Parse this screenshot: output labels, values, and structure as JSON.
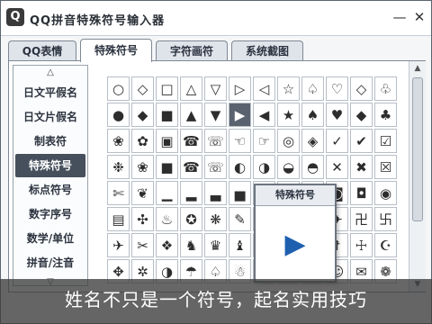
{
  "window": {
    "title": "QQ拼音特殊符号输入器",
    "app_icon": "Q",
    "minimize_glyph": "—",
    "close_glyph": "✕"
  },
  "tabs": [
    {
      "label": "QQ表情"
    },
    {
      "label": "特殊符号"
    },
    {
      "label": "字符画符"
    },
    {
      "label": "系统截图"
    }
  ],
  "categories": {
    "up_glyph": "△",
    "down_glyph": "▽",
    "items": [
      {
        "label": "日文平假名"
      },
      {
        "label": "日文片假名"
      },
      {
        "label": "制表符"
      },
      {
        "label": "特殊符号"
      },
      {
        "label": "标点符号"
      },
      {
        "label": "数字序号"
      },
      {
        "label": "数学/单位"
      },
      {
        "label": "拼音/注音"
      }
    ]
  },
  "symbols": {
    "rows": [
      [
        "○",
        "◇",
        "□",
        "△",
        "▽",
        "▷",
        "◁",
        "☆",
        "♤",
        "♡",
        "◇",
        "♧"
      ],
      [
        "●",
        "◆",
        "■",
        "▲",
        "▼",
        "▶",
        "◀",
        "★",
        "♠",
        "♥",
        "◆",
        "♣"
      ],
      [
        "❀",
        "✿",
        "▣",
        "☎",
        "☏",
        "☜",
        "☞",
        "◎",
        "◈",
        "✓",
        "✔",
        "☑"
      ],
      [
        "❉",
        "❀",
        "■",
        "☎",
        "☏",
        "◐",
        "◑",
        "◒",
        "◓",
        "✕",
        "✖",
        "☒"
      ],
      [
        "✄",
        "❦",
        "▁",
        "▂",
        "▃",
        "▅",
        "▆",
        "▇",
        "█",
        "◙",
        "◘",
        "◉"
      ],
      [
        "▤",
        "✣",
        "♨",
        "✪",
        "❋",
        "✎",
        "✐",
        "✂",
        "✁",
        "✈",
        "卍",
        "卐"
      ],
      [
        "✈",
        "✂",
        "❖",
        "♞",
        "♛",
        "♝",
        "✙",
        "✝",
        "✞",
        "☨",
        "☩",
        "☪"
      ],
      [
        "✥",
        "✲",
        "◑",
        "☂",
        "♤",
        "☃",
        "☘",
        "❄",
        "☻",
        "☺",
        "✉",
        "❁"
      ]
    ],
    "selected_row": 1,
    "selected_col": 5
  },
  "preview": {
    "title": "特殊符号",
    "symbol": "▶"
  },
  "scrollbar": {
    "up_glyph": "▲",
    "down_glyph": "▼"
  },
  "caption": {
    "text": "姓名不只是一个符号，起名实用技巧"
  },
  "colors": {
    "selected_bg": "#5a6270",
    "preview_symbol": "#1e5fb0"
  }
}
